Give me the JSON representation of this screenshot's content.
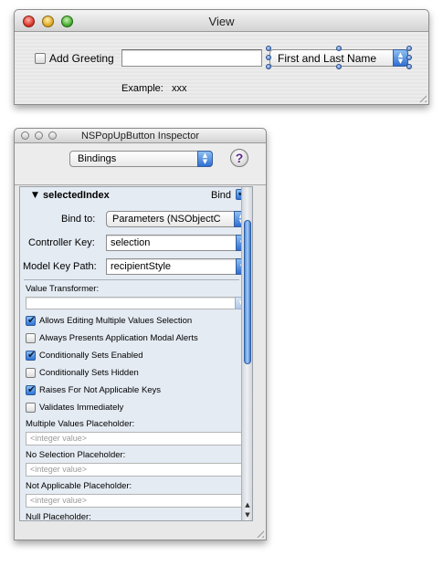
{
  "view_window": {
    "title": "View",
    "checkbox_label": "Add Greeting",
    "checkbox_checked": false,
    "text_field_value": "",
    "popup_selected": "First and Last Name",
    "example_label": "Example:",
    "example_value": "xxx"
  },
  "inspector": {
    "title": "NSPopUpButton Inspector",
    "pane_selector": "Bindings",
    "help_glyph": "?",
    "binding": {
      "disclosure_icon": "disclosure-triangle-down",
      "name": "selectedIndex",
      "bind_label": "Bind",
      "bind_checked": true,
      "bind_to_label": "Bind to:",
      "bind_to_value": "Parameters (NSObjectC",
      "controller_key_label": "Controller Key:",
      "controller_key_value": "selection",
      "model_key_path_label": "Model Key Path:",
      "model_key_path_value": "recipientStyle",
      "value_transformer_label": "Value Transformer:",
      "value_transformer_value": ""
    },
    "options": [
      {
        "label": "Allows Editing Multiple Values Selection",
        "checked": true
      },
      {
        "label": "Always Presents Application Modal Alerts",
        "checked": false
      },
      {
        "label": "Conditionally Sets Enabled",
        "checked": true
      },
      {
        "label": "Conditionally Sets Hidden",
        "checked": false
      },
      {
        "label": "Raises For Not Applicable Keys",
        "checked": true
      },
      {
        "label": "Validates Immediately",
        "checked": false
      }
    ],
    "placeholders": [
      {
        "label": "Multiple Values Placeholder:",
        "value": "<integer value>"
      },
      {
        "label": "No Selection Placeholder:",
        "value": "<integer value>"
      },
      {
        "label": "Not Applicable Placeholder:",
        "value": "<integer value>"
      },
      {
        "label": "Null Placeholder:",
        "value": ""
      }
    ]
  },
  "colors": {
    "accent_blue": "#2e6fd2",
    "close_red": "#d42a1e",
    "minimize_yellow": "#d9a118",
    "zoom_green": "#3aa324",
    "pane_background": "#e4ebf3"
  }
}
